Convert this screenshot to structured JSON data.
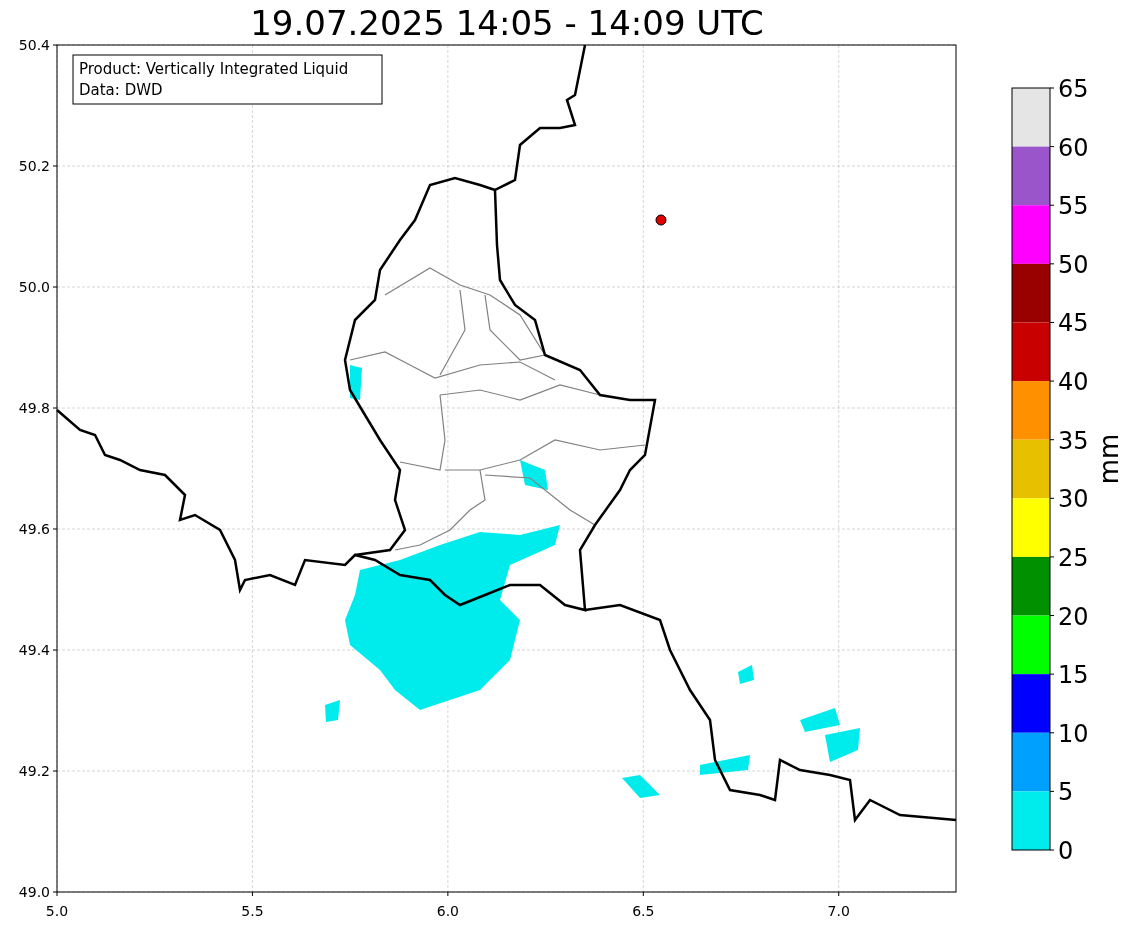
{
  "title": "19.07.2025 14:05 - 14:09 UTC",
  "info_box": {
    "lines": [
      "Product: Vertically Integrated Liquid",
      "Data: DWD"
    ]
  },
  "map": {
    "xticks": [
      "5.0",
      "5.5",
      "6.0",
      "6.5",
      "7.0"
    ],
    "yticks": [
      "50.4",
      "50.2",
      "50.0",
      "49.8",
      "49.6",
      "49.4",
      "49.2",
      "49.0"
    ]
  },
  "colorbar": {
    "label": "mm",
    "ticks": [
      "65",
      "60",
      "55",
      "50",
      "45",
      "40",
      "35",
      "30",
      "25",
      "20",
      "15",
      "10",
      "5",
      "0"
    ],
    "bins": [
      {
        "color": "#e5e5e5"
      },
      {
        "color": "#9955c9"
      },
      {
        "color": "#ff00ff"
      },
      {
        "color": "#990000"
      },
      {
        "color": "#c80000"
      },
      {
        "color": "#ff9000"
      },
      {
        "color": "#e7c000"
      },
      {
        "color": "#ffff00"
      },
      {
        "color": "#009000"
      },
      {
        "color": "#00ff00"
      },
      {
        "color": "#0000ff"
      },
      {
        "color": "#00a0ff"
      },
      {
        "color": "#00ecec"
      }
    ]
  }
}
